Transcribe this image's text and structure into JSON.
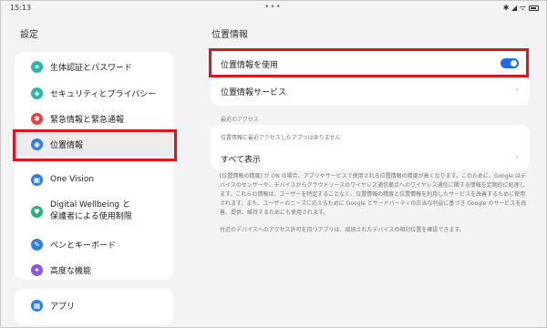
{
  "status_bar": {
    "time": "15:13",
    "dots": "•••",
    "icons": "✱ ◢ ᯤ"
  },
  "left_title": "設定",
  "nav": [
    {
      "label": "生体認証とパスワード",
      "icon": "lock-icon",
      "color": "#2bb5a6"
    },
    {
      "label": "セキュリティとプライバシー",
      "icon": "shield-icon",
      "color": "#2bb5a6"
    },
    {
      "label": "緊急情報と緊急通報",
      "icon": "emergency-icon",
      "color": "#e8403a"
    },
    {
      "label": "位置情報",
      "icon": "location-icon",
      "color": "#2f7de1"
    },
    {
      "label": "One Vision",
      "icon": "one-vision-icon",
      "color": "#2f7de1"
    },
    {
      "label": "Digital Wellbeing と\n保護者による使用制限",
      "icon": "wellbeing-icon",
      "color": "#2bb07a"
    },
    {
      "label": "ペンとキーボード",
      "icon": "pen-icon",
      "color": "#2f7de1"
    },
    {
      "label": "高度な機能",
      "icon": "advanced-icon",
      "color": "#8b5bd6"
    },
    {
      "label": "アプリ",
      "icon": "apps-icon",
      "color": "#2f7de1"
    }
  ],
  "right_title": "位置情報",
  "use_location": {
    "label": "位置情報を使用",
    "enabled": true
  },
  "location_services": {
    "label": "位置情報サービス"
  },
  "recent_access": {
    "section_label": "最近のアクセス",
    "empty_note": "位置情報に最近アクセスしたアプリはありません",
    "show_all": "すべて表示"
  },
  "accuracy_paragraph": "[位置情報の精度] が ON の場合、アプリやサービスで使用される位置情報の精度が高くなります。このために、Google はデバイスのセンサーや、デバイスからクラウドソースのワイヤレス通信拠点へのワイヤレス通信に関する情報を定期的に処理します。これらの情報は、ユーザーを特定することなく、位置情報の精度と位置情報を利用したサービスを改善するために使用されます。また、ユーザーのニーズに応えるために Google とサードパーティの正当な利益に基づき Google のサービスを改善、提供、維持するためにも使用されます。",
  "nearby_paragraph": "付近のデバイスへのアクセス許可を持つアプリは、接続されたデバイスの相対位置を確認できます。",
  "colors": {
    "accent": "#1c6ee8",
    "highlight": "#e0141e"
  }
}
